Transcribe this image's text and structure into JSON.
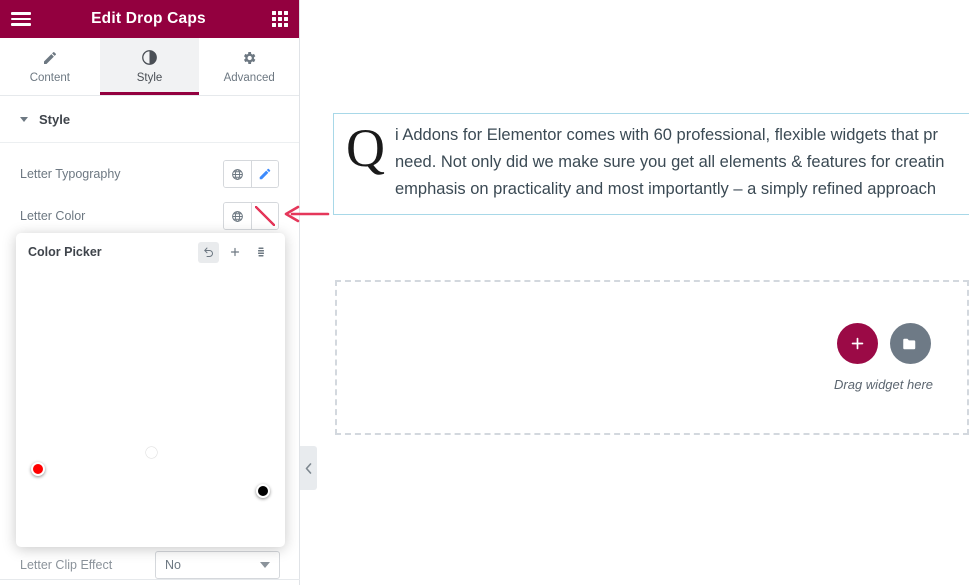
{
  "panel": {
    "header": {
      "title": "Edit Drop Caps",
      "menu_icon": "hamburger-icon",
      "apps_icon": "grid-apps-icon",
      "bg_color": "#93003f"
    },
    "tabs": [
      {
        "label": "Content",
        "icon": "pencil-icon",
        "active": false
      },
      {
        "label": "Style",
        "icon": "half-circle-icon",
        "active": true
      },
      {
        "label": "Advanced",
        "icon": "gear-icon",
        "active": false
      }
    ],
    "section": {
      "title": "Style",
      "caret_icon": "caret-down-icon"
    },
    "controls": [
      {
        "label": "Letter Typography",
        "global_icon": "globe-icon",
        "action_icon": "pencil-edit-icon"
      },
      {
        "label": "Letter Color",
        "global_icon": "globe-icon",
        "action_icon": "no-color-swatch-icon"
      }
    ],
    "clip_effect": {
      "label": "Letter Clip Effect",
      "value": "No",
      "caret_icon": "caret-down-icon"
    }
  },
  "color_picker": {
    "title": "Color Picker",
    "actions": [
      {
        "name": "reset",
        "icon": "undo-reset-icon",
        "active": true
      },
      {
        "name": "add",
        "icon": "plus-icon",
        "active": false
      },
      {
        "name": "palette",
        "icon": "layers-palette-icon",
        "active": false
      }
    ],
    "hex_value": "#020101",
    "hex_selected": true,
    "hue": {
      "handle_position": "left",
      "handle_color": "#ff0000"
    },
    "alpha": {
      "handle_position": "right",
      "handle_color": "#000000"
    },
    "swatch_hue": "#ff0000"
  },
  "annotation": {
    "arrow_icon": "left-arrow-annotation-icon",
    "color": "#e5375a"
  },
  "collapse_handle": {
    "icon": "chevron-left-icon"
  },
  "canvas": {
    "dropcap": {
      "letter": "Q",
      "body": "i Addons for Elementor comes with 60 professional, flexible widgets that pr\nneed. Not only did we make sure you get all elements & features for creatin\nemphasis on practicality and most importantly – a simply refined approach"
    },
    "drop_area": {
      "label": "Drag widget here",
      "add_icon": "plus-icon",
      "folder_icon": "folder-icon",
      "add_color": "#9b0a46",
      "folder_color": "#6e7a86"
    }
  }
}
